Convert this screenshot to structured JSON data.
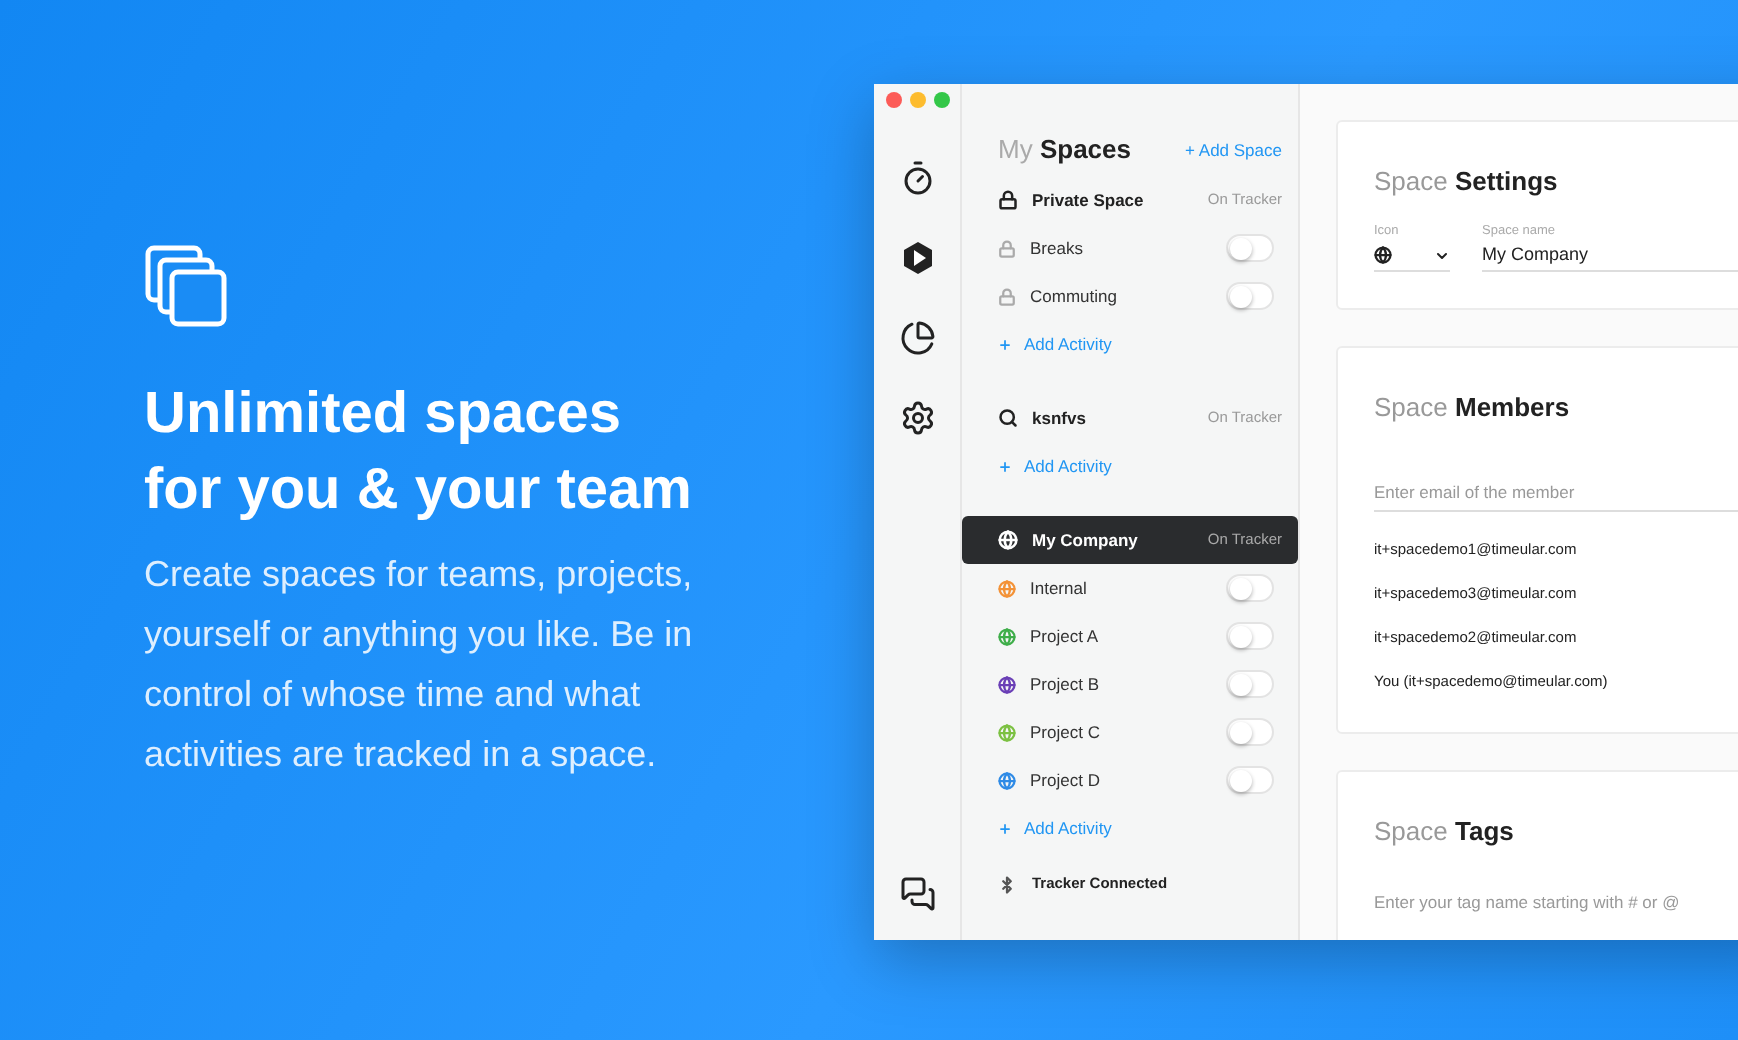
{
  "hero": {
    "title_lines": [
      "Unlimited spaces",
      "for you & your team"
    ],
    "body": "Create spaces for teams, projects, yourself or anything you like. Be in control of whose time and what activities are tracked in a space."
  },
  "app": {
    "spaces_panel": {
      "title_light": "My",
      "title_bold": "Spaces",
      "add_space": "+ Add Space",
      "groups": [
        {
          "kind": "private",
          "name": "Private Space",
          "status": "On Tracker",
          "selected": false,
          "activities": [
            {
              "name": "Breaks",
              "kind": "locked",
              "on": false
            },
            {
              "name": "Commuting",
              "kind": "locked",
              "on": false
            }
          ],
          "add_activity": "Add Activity"
        },
        {
          "kind": "search",
          "name": "ksnfvs",
          "status": "On Tracker",
          "selected": false,
          "add_activity": "Add Activity"
        },
        {
          "kind": "shared",
          "name": "My Company",
          "status": "On Tracker",
          "selected": true,
          "activities": [
            {
              "name": "Internal",
              "kind": "globe",
              "color": "#f39237",
              "on": false
            },
            {
              "name": "Project A",
              "kind": "globe",
              "color": "#3fae4a",
              "on": false
            },
            {
              "name": "Project B",
              "kind": "globe",
              "color": "#6a3fb6",
              "on": false
            },
            {
              "name": "Project C",
              "kind": "globe",
              "color": "#7cc142",
              "on": false
            },
            {
              "name": "Project D",
              "kind": "globe",
              "color": "#2f8be6",
              "on": false
            }
          ],
          "add_activity": "Add Activity"
        }
      ],
      "tracker_status": "Tracker Connected"
    },
    "settings": {
      "title_light": "Space",
      "title_bold": "Settings",
      "icon_label": "Icon",
      "name_label": "Space name",
      "name_value": "My Company"
    },
    "members": {
      "title_light": "Space",
      "title_bold": "Members",
      "placeholder": "Enter email of the member",
      "list": [
        "it+spacedemo1@timeular.com",
        "it+spacedemo3@timeular.com",
        "it+spacedemo2@timeular.com",
        "You (it+spacedemo@timeular.com)"
      ]
    },
    "tags": {
      "title_light": "Space",
      "title_bold": "Tags",
      "placeholder": "Enter your tag name starting with # or @"
    }
  }
}
